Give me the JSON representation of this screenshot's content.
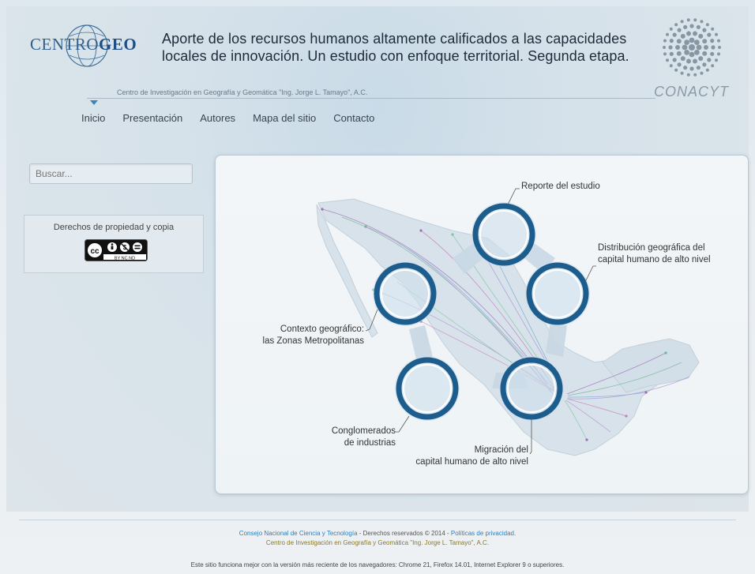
{
  "header": {
    "logo_part1": "CENTRO",
    "logo_part2": "GEO",
    "title_line1": "Aporte de los recursos humanos altamente calificados a las capacidades",
    "title_line2": "locales de innovación. Un estudio con enfoque territorial. Segunda etapa.",
    "tagline": "Centro de Investigación en Geografía y Geomática \"Ing. Jorge L. Tamayo\", A.C.",
    "partner_logo": "CONACYT"
  },
  "nav": {
    "items": [
      {
        "label": "Inicio"
      },
      {
        "label": "Presentación"
      },
      {
        "label": "Autores"
      },
      {
        "label": "Mapa del sitio"
      },
      {
        "label": "Contacto"
      }
    ]
  },
  "sidebar": {
    "search_placeholder": "Buscar...",
    "copyright_title": "Derechos de propiedad y copia",
    "cc_label": "BY NC ND"
  },
  "diagram": {
    "labels": {
      "reporte": "Reporte del estudio",
      "distribucion_1": "Distribución geográfica del",
      "distribucion_2": "capital humano de alto nivel",
      "contexto_1": "Contexto geográfico:",
      "contexto_2": "las Zonas Metropolitanas",
      "conglomerados_1": "Conglomerados",
      "conglomerados_2": "de industrias",
      "migracion_1": "Migración del",
      "migracion_2": "capital humano de alto nivel"
    }
  },
  "footer": {
    "org": "Consejo Nacional de Ciencia y Tecnología",
    "rights": " - Derechos reservados © 2014 - ",
    "privacy": "Políticas de privacidad.",
    "center": "Centro de Investigación en Geografía y Geomática \"Ing. Jorge L. Tamayo\", A.C.",
    "browser_note": "Este sitio funciona mejor con la versión más reciente de los navegadores: Chrome 21, Firefox 14.01, Internet Explorer 9 o superiores."
  },
  "colors": {
    "accent": "#1f5f8e",
    "ring": "#1d5d8d",
    "link": "#2c7fb8"
  }
}
